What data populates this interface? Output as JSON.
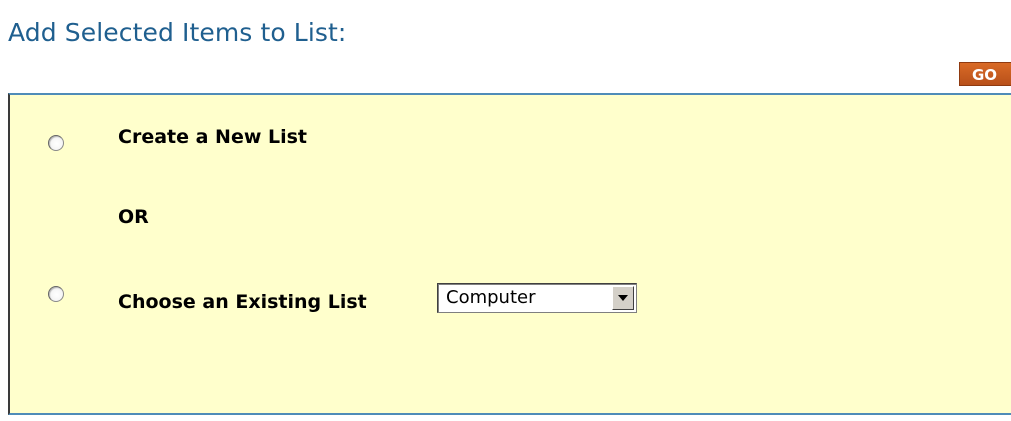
{
  "header": {
    "title": "Add Selected Items to List:",
    "go_label": "GO"
  },
  "options": {
    "create_label": "Create a New List",
    "or_label": "OR",
    "existing_label": "Choose an Existing List"
  },
  "list_select": {
    "selected_value": "Computer"
  },
  "icons": {
    "dropdown": "chevron-down-icon"
  },
  "colors": {
    "title": "#1f5f8f",
    "panel_background": "#ffffcc",
    "panel_border": "#4f8cb8",
    "go_button": "#c85a1e"
  }
}
